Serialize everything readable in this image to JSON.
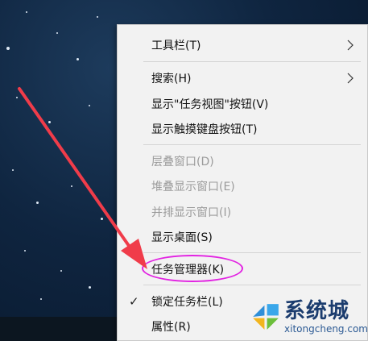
{
  "context_menu": {
    "items": [
      {
        "label": "工具栏(T)",
        "disabled": false,
        "has_submenu": true
      },
      {
        "label": "搜索(H)",
        "disabled": false,
        "has_submenu": true
      },
      {
        "label": "显示\"任务视图\"按钮(V)",
        "disabled": false
      },
      {
        "label": "显示触摸键盘按钮(T)",
        "disabled": false
      },
      {
        "label": "层叠窗口(D)",
        "disabled": true
      },
      {
        "label": "堆叠显示窗口(E)",
        "disabled": true
      },
      {
        "label": "并排显示窗口(I)",
        "disabled": true
      },
      {
        "label": "显示桌面(S)",
        "disabled": false
      },
      {
        "label": "任务管理器(K)",
        "disabled": false,
        "highlighted": true
      },
      {
        "label": "锁定任务栏(L)",
        "disabled": false,
        "checked": true
      },
      {
        "label": "属性(R)",
        "disabled": false
      }
    ]
  },
  "annotation": {
    "highlight_color": "#e224e2",
    "arrow_color": "#f03c4a"
  },
  "watermark": {
    "name": "系统城",
    "url": "xitongcheng.com"
  }
}
